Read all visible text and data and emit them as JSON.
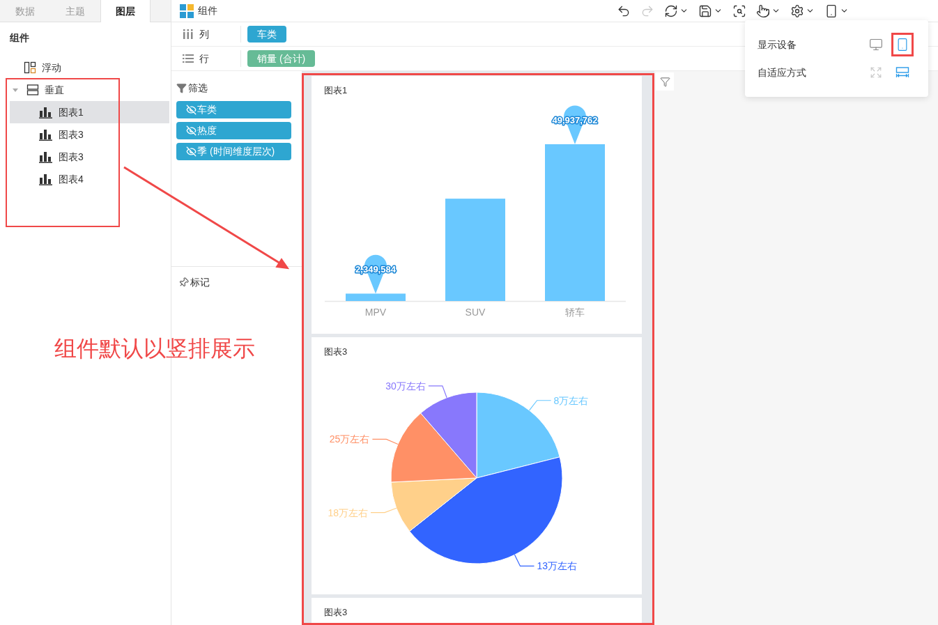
{
  "panel_tabs": [
    {
      "label": "数据",
      "selected": false
    },
    {
      "label": "主题",
      "selected": false
    },
    {
      "label": "图层",
      "selected": true
    }
  ],
  "layer_panel": {
    "heading": "组件",
    "tree": [
      {
        "label": "浮动",
        "kind": "float"
      },
      {
        "label": "垂直",
        "kind": "vertical",
        "expanded": true,
        "children": [
          {
            "label": "图表1",
            "kind": "chart",
            "selected": true
          },
          {
            "label": "图表3",
            "kind": "chart",
            "selected": false
          },
          {
            "label": "图表3",
            "kind": "chart",
            "selected": false
          },
          {
            "label": "图表4",
            "kind": "chart",
            "selected": false
          }
        ]
      }
    ]
  },
  "toolbar": {
    "title": "组件",
    "buttons": [
      {
        "kind": "undo",
        "disabled": false,
        "dropdown": false
      },
      {
        "kind": "redo",
        "disabled": true,
        "dropdown": false
      },
      {
        "kind": "refresh",
        "disabled": false,
        "dropdown": true
      },
      {
        "kind": "save",
        "disabled": false,
        "dropdown": true
      },
      {
        "kind": "preview",
        "disabled": false,
        "dropdown": false
      },
      {
        "kind": "interact",
        "disabled": false,
        "dropdown": true
      },
      {
        "kind": "settings",
        "disabled": false,
        "dropdown": true
      },
      {
        "kind": "device",
        "disabled": false,
        "dropdown": true
      }
    ]
  },
  "shelves": [
    {
      "label": "列",
      "kind": "columns",
      "fields": [
        {
          "label": "车类",
          "kind": "dimension"
        }
      ]
    },
    {
      "label": "行",
      "kind": "rows",
      "fields": [
        {
          "label": "销量 (合计)",
          "kind": "measure"
        }
      ]
    }
  ],
  "filter_panel": {
    "title": "筛选",
    "fields": [
      {
        "label": "车类"
      },
      {
        "label": "热度"
      },
      {
        "label": "季 (时间维度层次)"
      }
    ]
  },
  "marks_panel": {
    "title": "标记"
  },
  "canvas": {
    "widgets": [
      {
        "title": "图表1",
        "kind": "bar",
        "chart_data": {
          "type": "bar",
          "categories": [
            "MPV",
            "SUV",
            "轿车"
          ],
          "values": [
            2349584,
            32600000,
            49937762
          ],
          "value_labels": [
            "2,349,584",
            null,
            "49,937,762"
          ]
        }
      },
      {
        "title": "图表3",
        "kind": "pie",
        "labels": [
          {
            "text": "8万左右",
            "color": "#69c8ff"
          },
          {
            "text": "13万左右",
            "color": "#3264ff"
          },
          {
            "text": "18万左右",
            "color": "#ffd08a"
          },
          {
            "text": "25万左右",
            "color": "#ff9066"
          },
          {
            "text": "30万左右",
            "color": "#8878fc"
          }
        ]
      },
      {
        "title": "图表3"
      }
    ]
  },
  "display_popover": {
    "rows": [
      {
        "label": "显示设备",
        "options": [
          {
            "kind": "desktop",
            "selected": false
          },
          {
            "kind": "mobile",
            "selected": true
          }
        ]
      },
      {
        "label": "自适应方式",
        "options": [
          {
            "kind": "expand",
            "selected": false
          },
          {
            "kind": "fit-width",
            "selected": true
          }
        ]
      }
    ]
  },
  "annotations": {
    "caption": "组件默认以竖排展示"
  }
}
